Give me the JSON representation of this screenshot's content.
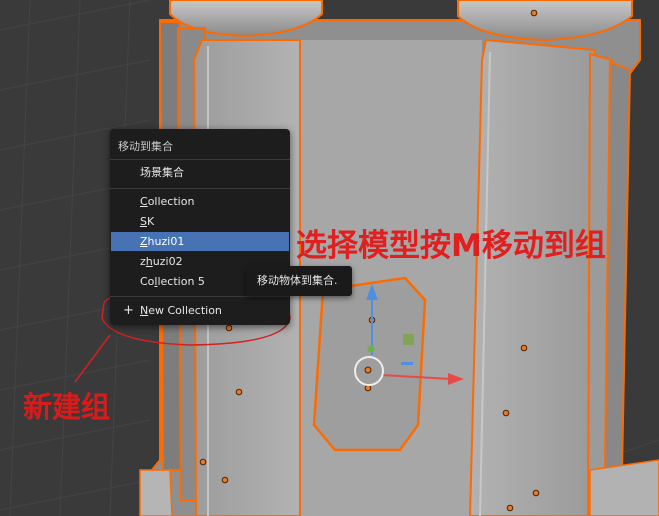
{
  "menu": {
    "title": "移动到集合",
    "scene_collection": "场景集合",
    "items": [
      {
        "pre": "",
        "u": "C",
        "post": "ollection"
      },
      {
        "pre": "",
        "u": "S",
        "post": "K"
      },
      {
        "pre": "",
        "u": "Z",
        "post": "huzi01"
      },
      {
        "pre": "z",
        "u": "h",
        "post": "uzi02"
      },
      {
        "pre": "Co",
        "u": "l",
        "post": "lection 5"
      }
    ],
    "new_collection": {
      "pre": "",
      "u": "N",
      "post": "ew Collection"
    },
    "plus_icon": "+"
  },
  "tooltip": "移动物体到集合.",
  "annotations": {
    "main": "选择模型按M移动到组",
    "new_group": "新建组"
  },
  "colors": {
    "selection_outline": "#ff6a00",
    "menu_highlight": "#4772b3",
    "annotation_red": "#e11f1f"
  }
}
